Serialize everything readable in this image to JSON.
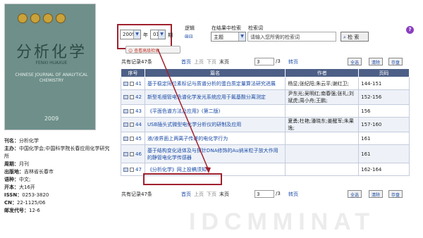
{
  "journal": {
    "cover_title": "分析化学",
    "cover_pinyin": "FENXI HUAXUE",
    "cover_en": "CHINESE JOURNAL OF ANALYTICAL CHEMISTRY",
    "cover_year": "2009",
    "fields": [
      {
        "k": "刊名：",
        "v": "分析化学"
      },
      {
        "k": "主办：",
        "v": "中国化学会;中国科学院长春应用化学研究所"
      },
      {
        "k": "周期：",
        "v": "月刊"
      },
      {
        "k": "出版地：",
        "v": "吉林省长春市"
      },
      {
        "k": "语种：",
        "v": "中文;"
      },
      {
        "k": "开本：",
        "v": "大16开"
      },
      {
        "k": "ISSN：",
        "v": "0253-3820"
      },
      {
        "k": "CN：",
        "v": "22-1125/06"
      },
      {
        "k": "邮发代号：",
        "v": "12-6"
      }
    ]
  },
  "filter": {
    "year": "2009",
    "year_unit": "年",
    "issue": "01",
    "issue_unit": "期",
    "advanced": "☺ 查看高级检索"
  },
  "search": {
    "logic_label": "逻辑",
    "in_results_label": "在结果中检索",
    "term_label": "检索词",
    "logic_op": "⊞⊟",
    "field": "主题",
    "placeholder": "请输入您所需的检索词",
    "button": "检 索"
  },
  "toolbar": {
    "total": "共有记录47条",
    "first": "首页",
    "prev": "上页",
    "next": "下页",
    "last": "末页",
    "page": "3",
    "page_total": "/3",
    "go": "转页",
    "select_all": "全选",
    "clear": "清除",
    "save": "存盘"
  },
  "table": {
    "headers": [
      "序号",
      "篇名",
      "作者",
      "页码"
    ],
    "rows": [
      {
        "no": "41",
        "title": "基于稳定同位素标记与质谱分析的蛋白质定量算法研究进展",
        "author": "杨显;张纪阳;朱云平;谢红卫;",
        "pages": "144-151"
      },
      {
        "no": "42",
        "title": "新型毛细管电色谱化学发光系统应用于氟基酸分离测定",
        "author": "尹东光;吴明红;南春强;张礼;刘斌虎;周小舟;王鹏;",
        "pages": "152-156"
      },
      {
        "no": "43",
        "title": "《平面色谱方法及应用》(第二版)",
        "author": "",
        "pages": "156"
      },
      {
        "no": "44",
        "title": "USB插头式微型电化学分析仪的研制及应用",
        "author": "夏勇;杜艳;潘晓东;姜醒军;朱果逸;",
        "pages": "157-160"
      },
      {
        "no": "45",
        "title": "液/液界面上两离子传递的电化学行为",
        "author": "",
        "pages": "161"
      },
      {
        "no": "46",
        "title": "基于结构变化适体及与探针DNA修饰的Au纳米粒子放大作用的静管电化学传感器",
        "author": "",
        "pages": "161"
      },
      {
        "no": "47",
        "title": "《分析化学》网上投稿须知",
        "author": "",
        "pages": "162-164"
      }
    ]
  },
  "watermark": "IDCMMINAT"
}
